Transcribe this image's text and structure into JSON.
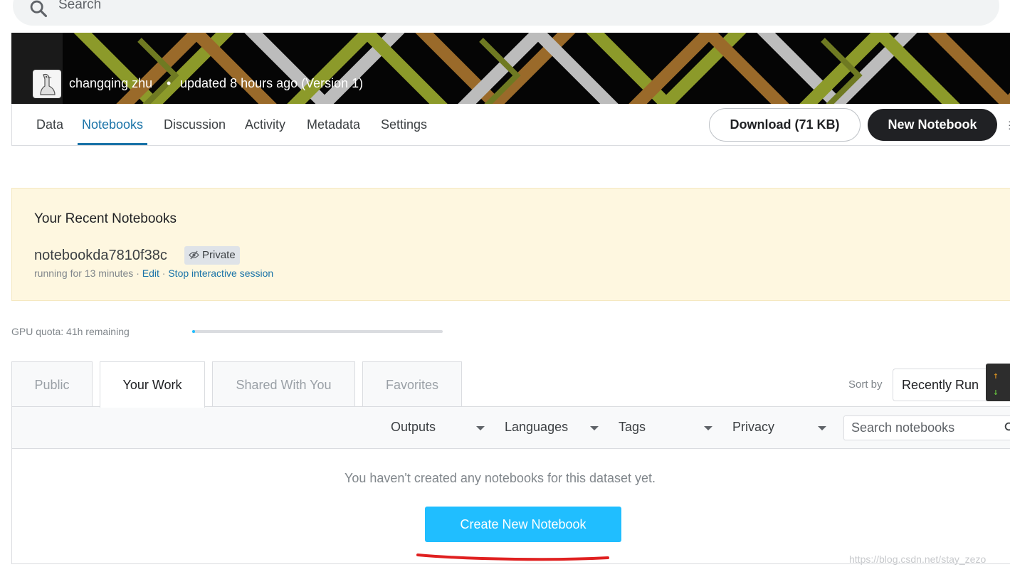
{
  "search": {
    "placeholder": "Search",
    "icon": "search-icon"
  },
  "banner": {
    "owner": "changqing zhu",
    "separator": "•",
    "updated": "updated 8 hours ago (Version 1)"
  },
  "nav": {
    "tabs": [
      {
        "label": "Data"
      },
      {
        "label": "Notebooks",
        "active": true
      },
      {
        "label": "Discussion"
      },
      {
        "label": "Activity"
      },
      {
        "label": "Metadata"
      },
      {
        "label": "Settings"
      }
    ],
    "download_label": "Download (71 KB)",
    "new_notebook_label": "New Notebook"
  },
  "recent": {
    "title": "Your Recent Notebooks",
    "notebook_name": "notebookda7810f38c",
    "badge": "Private",
    "running": "running for 13 minutes",
    "sep": "·",
    "edit": "Edit",
    "stop": "Stop interactive session"
  },
  "gpu": {
    "label": "GPU quota: 41h remaining",
    "used_fraction": 0.01
  },
  "work_tabs": [
    {
      "label": "Public"
    },
    {
      "label": "Your Work",
      "active": true
    },
    {
      "label": "Shared With You"
    },
    {
      "label": "Favorites"
    }
  ],
  "sort": {
    "label": "Sort by",
    "value": "Recently Run"
  },
  "net_widget": {
    "up": "↑",
    "down": "↓"
  },
  "filters": {
    "outputs": "Outputs",
    "languages": "Languages",
    "tags": "Tags",
    "privacy": "Privacy",
    "search_placeholder": "Search notebooks"
  },
  "empty": {
    "message": "You haven't created any notebooks for this dataset yet.",
    "create_label": "Create New Notebook"
  },
  "watermark": "https://blog.csdn.net/stay_zezo",
  "colors": {
    "accent_blue": "#1a73a8",
    "cta_blue": "#20beff",
    "recent_bg": "#fef7e0",
    "annotation_red": "#e02020"
  }
}
